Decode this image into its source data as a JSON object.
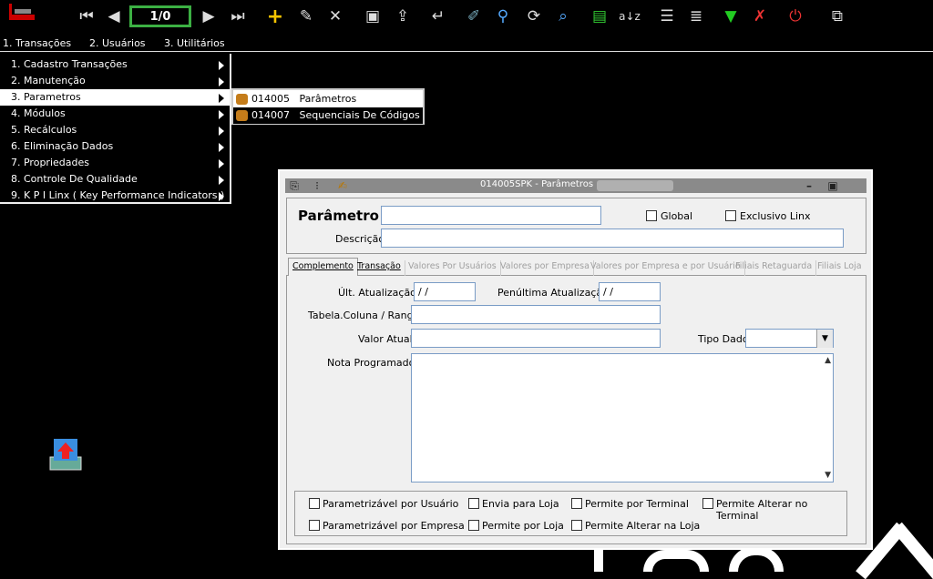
{
  "toolbar": {
    "record_counter": "1/0",
    "icons": [
      "first-icon",
      "prev-icon",
      "next-icon",
      "last-icon",
      "add-icon",
      "edit-icon",
      "delete-icon",
      "save-icon",
      "save-new-icon",
      "undo-icon",
      "clear-icon",
      "search-icon",
      "refresh-icon",
      "find-icon",
      "print-icon",
      "sort-icon",
      "add-note-icon",
      "list-icon",
      "download-icon",
      "tool-icon",
      "stop-icon",
      "window-switch-icon"
    ]
  },
  "menubar": {
    "items": [
      "1. Transações",
      "2. Usuários",
      "3. Utilitários"
    ]
  },
  "dropdown": {
    "items": [
      "1. Cadastro Transações",
      "2. Manutenção",
      "3. Parametros",
      "4. Módulos",
      "5. Recálculos",
      "6. Eliminação Dados",
      "7. Propriedades",
      "8. Controle De Qualidade",
      "9. K P I  Linx ( Key Performance Indicators  )"
    ],
    "active_index": 2
  },
  "submenu": {
    "items": [
      {
        "code": "014005",
        "label": "Parâmetros"
      },
      {
        "code": "014007",
        "label": "Sequenciais De Códigos"
      }
    ],
    "active_index": 1
  },
  "window": {
    "title": "014005SPK - Parâmetros",
    "parametro_label": "Parâmetro",
    "parametro_value": "",
    "global_label": "Global",
    "exclusivo_label": "Exclusivo Linx",
    "descricao_label": "Descrição",
    "descricao_value": "",
    "tabs": [
      "Complemento",
      "Transação",
      "Valores Por Usuários",
      "Valores por Empresa",
      "Valores por Empresa e por Usuário",
      "Filiais Retaguarda",
      "Filiais Loja"
    ],
    "ult_atualizacao_label": "Últ. Atualização",
    "ult_atualizacao_value": "/ /",
    "penultima_label": "Penúltima Atualização",
    "penultima_value": "/ /",
    "tabela_label": "Tabela.Coluna / Range",
    "valor_atual_label": "Valor Atual",
    "tipo_dado_label": "Tipo Dado",
    "nota_label": "Nota Programador",
    "checkboxes": [
      "Parametrizável por Usuário",
      "Envia para Loja",
      "Permite por Terminal",
      "Permite Alterar no Terminal",
      "Parametrizável por Empresa",
      "Permite por Loja",
      "Permite Alterar na Loja"
    ]
  }
}
